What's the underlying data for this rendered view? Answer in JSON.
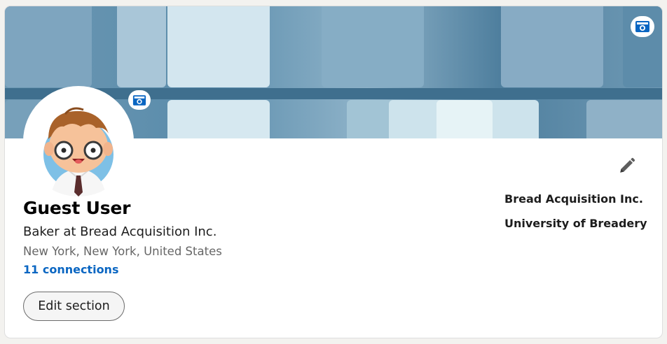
{
  "profile": {
    "name": "Guest User",
    "headline": "Baker at Bread Acquisition Inc.",
    "location": "New York, New York, United States",
    "connections": "11 connections"
  },
  "actions": {
    "edit_section_label": "Edit section"
  },
  "right_panel": {
    "items": [
      "Bread Acquisition Inc.",
      "University of Breadery"
    ]
  },
  "icons": {
    "banner_camera": "camera-icon",
    "avatar_camera": "camera-icon",
    "edit": "pencil-icon"
  },
  "colors": {
    "link": "#0a66c2",
    "background": "#f3f2ef",
    "card": "#ffffff"
  }
}
